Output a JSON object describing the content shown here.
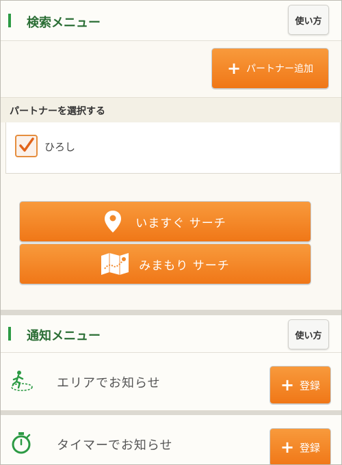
{
  "search_menu": {
    "title": "検索メニュー",
    "help_label": "使い方",
    "add_partner_label": "パートナー追加",
    "select_partner_label": "パートナーを選択する",
    "partners": [
      {
        "name": "ひろし",
        "checked": true
      }
    ],
    "search_now_label": "いますぐ サーチ",
    "watch_search_label": "みまもり サーチ"
  },
  "notify_menu": {
    "title": "通知メニュー",
    "help_label": "使い方",
    "items": [
      {
        "label": "エリアでお知らせ",
        "icon": "area-run-icon",
        "button_label": "登録"
      },
      {
        "label": "タイマーでお知らせ",
        "icon": "stopwatch-icon",
        "button_label": "登録"
      }
    ]
  },
  "colors": {
    "accent_orange": "#f07717",
    "header_green": "#2b6e35",
    "bar_green": "#2c9a44"
  }
}
